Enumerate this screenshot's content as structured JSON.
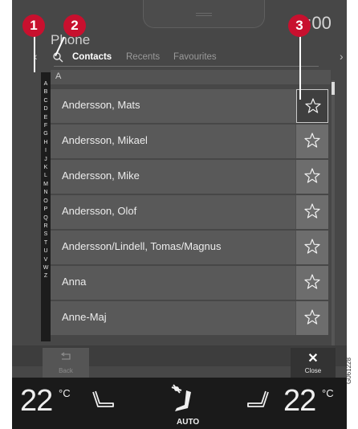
{
  "status_bar": {
    "clock": "0:00"
  },
  "app": {
    "title": "Phone"
  },
  "tabs": [
    {
      "label": "Contacts",
      "active": true
    },
    {
      "label": "Recents",
      "active": false
    },
    {
      "label": "Favourites",
      "active": false
    }
  ],
  "section": {
    "letter": "A"
  },
  "az_index": [
    "A",
    "B",
    "C",
    "D",
    "E",
    "F",
    "G",
    "H",
    "I",
    "J",
    "K",
    "L",
    "M",
    "N",
    "O",
    "P",
    "Q",
    "R",
    "S",
    "T",
    "U",
    "V",
    "W",
    "Z"
  ],
  "contacts": [
    {
      "name": "Andersson, Mats",
      "favourite_selected": true
    },
    {
      "name": "Andersson, Mikael",
      "favourite_selected": false
    },
    {
      "name": "Andersson, Mike",
      "favourite_selected": false
    },
    {
      "name": "Andersson, Olof",
      "favourite_selected": false
    },
    {
      "name": "Andersson/Lindell, Tomas/Magnus",
      "favourite_selected": false
    },
    {
      "name": "Anna",
      "favourite_selected": false
    },
    {
      "name": "Anne-Maj",
      "favourite_selected": false
    }
  ],
  "buttons": {
    "back": "Back",
    "close": "Close",
    "close_symbol": "✕"
  },
  "climate": {
    "temp_left": "22",
    "temp_right": "22",
    "unit": "°C",
    "auto_label": "AUTO"
  },
  "callouts": [
    "1",
    "2",
    "3"
  ],
  "image_code": "G061228",
  "colors": {
    "callout": "#c8102e",
    "screen_bg": "#474747",
    "climate_bg": "#1a1a1a"
  },
  "icons": {
    "search": "search-icon",
    "star": "star-outline-icon",
    "back": "back-arrow-icon",
    "close": "close-icon",
    "seat_left": "seat-heating-left-icon",
    "seat_right": "seat-heating-right-icon",
    "fan": "fan-airflow-icon"
  }
}
